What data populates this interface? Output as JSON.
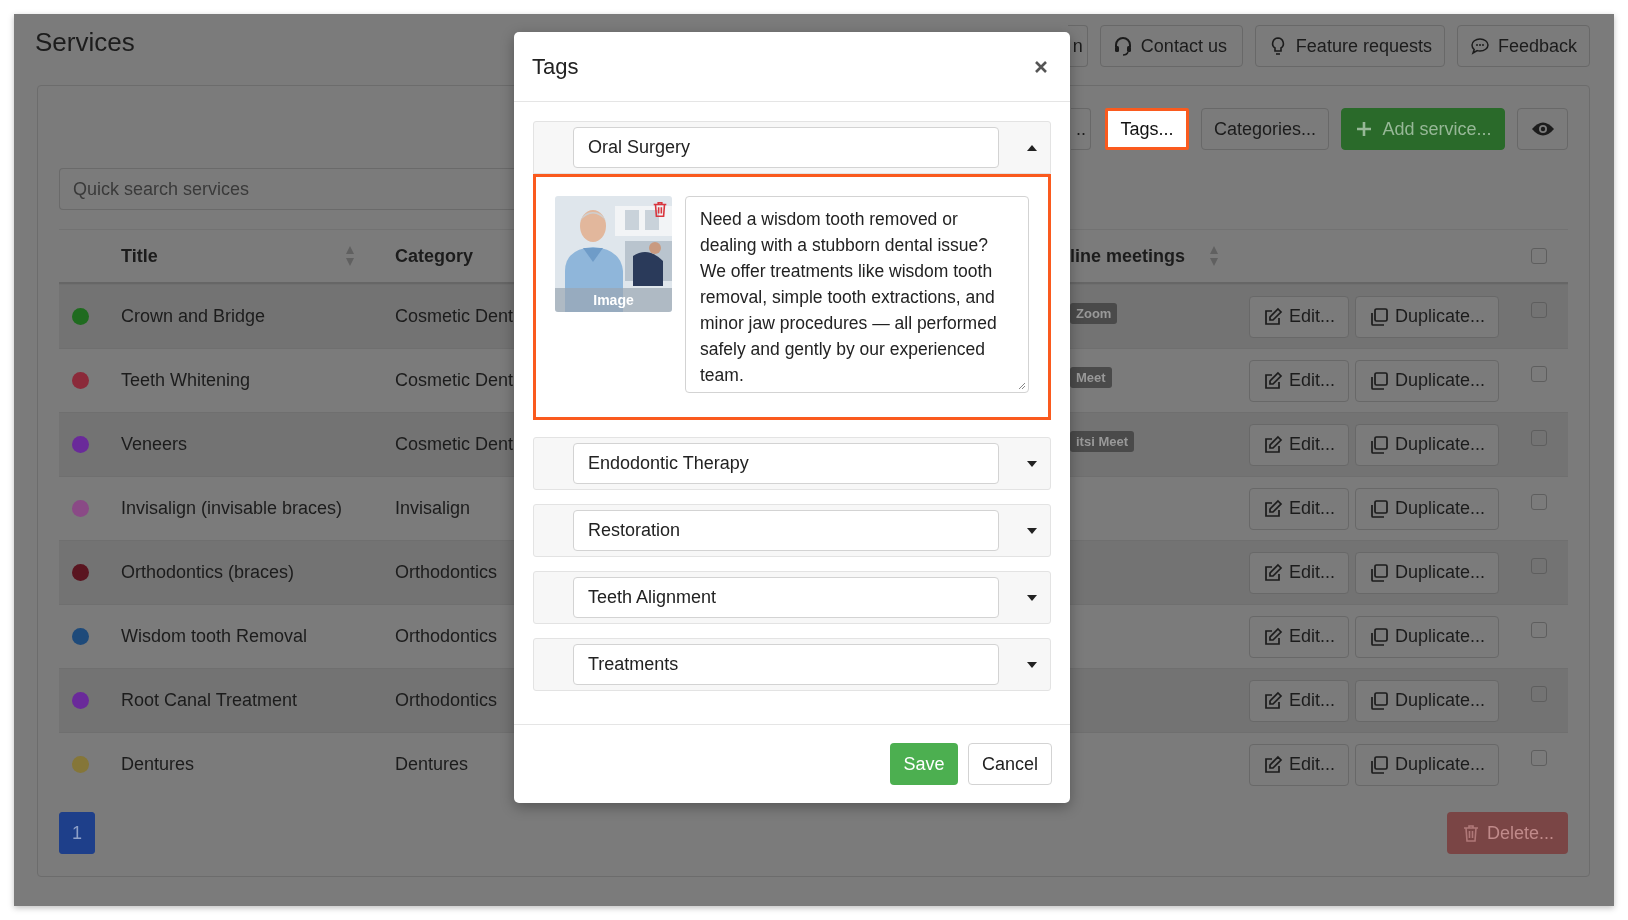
{
  "page": {
    "title": "Services"
  },
  "header_buttons": [
    {
      "label": "n",
      "kind": "partial"
    },
    {
      "label": "Contact us",
      "kind": "contact"
    },
    {
      "label": "Feature requests",
      "kind": "idea"
    },
    {
      "label": "Feedback",
      "kind": "feedback"
    }
  ],
  "toolbar": [
    {
      "label": "..",
      "kind": "partial",
      "highlighted": false
    },
    {
      "label": "Tags...",
      "kind": "plain",
      "highlighted": true
    },
    {
      "label": "Categories...",
      "kind": "plain",
      "highlighted": false
    },
    {
      "label": "Add service...",
      "kind": "add",
      "highlighted": false
    },
    {
      "kind": "eye",
      "highlighted": false
    }
  ],
  "search": {
    "placeholder": "Quick search services"
  },
  "table": {
    "columns": [
      {
        "label": "Title",
        "sortable": true
      },
      {
        "label": "Category",
        "sortable": false
      },
      {
        "label": "line meetings",
        "sortable": true
      }
    ],
    "select_all": {
      "checked": false
    },
    "rows": [
      {
        "color": "#1f6b1f",
        "title": "Crown and Bridge",
        "category": "Cosmetic Dent",
        "meeting": "Zoom",
        "edit": "Edit...",
        "duplicate": "Duplicate...",
        "checked": false
      },
      {
        "color": "#8b2a3a",
        "title": "Teeth Whitening",
        "category": "Cosmetic Dent",
        "meeting": "Meet",
        "edit": "Edit...",
        "duplicate": "Duplicate...",
        "checked": false
      },
      {
        "color": "#6a2a9a",
        "title": "Veneers",
        "category": "Cosmetic Dent",
        "meeting": "itsi Meet",
        "edit": "Edit...",
        "duplicate": "Duplicate...",
        "checked": false
      },
      {
        "color": "#8a4a86",
        "title": "Invisalign (invisable braces)",
        "category": "Invisalign",
        "edit": "Edit...",
        "duplicate": "Duplicate...",
        "checked": false
      },
      {
        "color": "#5a1520",
        "title": "Orthodontics (braces)",
        "category": "Orthodontics",
        "edit": "Edit...",
        "duplicate": "Duplicate...",
        "checked": false
      },
      {
        "color": "#1e4a7a",
        "title": "Wisdom tooth Removal",
        "category": "Orthodontics",
        "edit": "Edit...",
        "duplicate": "Duplicate...",
        "checked": false
      },
      {
        "color": "#6a2a9a",
        "title": "Root Canal Treatment",
        "category": "Orthodontics",
        "edit": "Edit...",
        "duplicate": "Duplicate...",
        "checked": false
      },
      {
        "color": "#857638",
        "title": "Dentures",
        "category": "Dentures",
        "edit": "Edit...",
        "duplicate": "Duplicate...",
        "checked": false
      }
    ]
  },
  "pagination": [
    {
      "label": "1",
      "selected": true
    }
  ],
  "delete_button": {
    "label": "Delete...",
    "disabled": true
  },
  "modal": {
    "title": "Tags",
    "items": [
      {
        "name": "Oral Surgery",
        "expanded": true,
        "highlighted": true,
        "image_label": "Image",
        "description": "Need a wisdom tooth removed or dealing with a stubborn dental issue? We offer treatments like wisdom tooth removal, simple tooth extractions, and minor jaw procedures — all performed safely and gently by our experienced team."
      },
      {
        "name": "Endodontic Therapy",
        "expanded": false
      },
      {
        "name": "Restoration",
        "expanded": false
      },
      {
        "name": "Teeth Alignment",
        "expanded": false
      },
      {
        "name": "Treatments",
        "expanded": false
      }
    ],
    "save": "Save",
    "cancel": "Cancel"
  }
}
